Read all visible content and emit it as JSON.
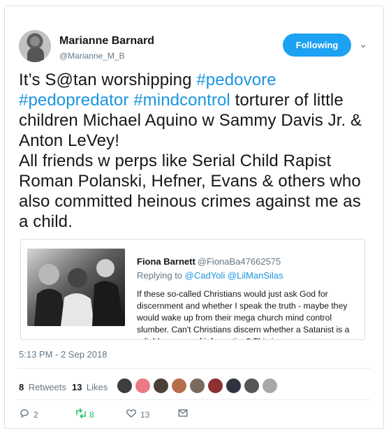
{
  "author": {
    "name": "Marianne Barnard",
    "handle": "@Marianne_M_B"
  },
  "follow_button_label": "Following",
  "tweet": {
    "text_parts": [
      "It’s S@tan worshipping ",
      "#pedovore",
      " ",
      "#pedopredator",
      " ",
      "#mindcontrol",
      " torturer of little children Michael Aquino w Sammy Davis Jr. & Anton LeVey!",
      "All friends w perps like Serial Child Rapist Roman Polanski, Hefner, Evans & others who also committed heinous crimes against me as a child."
    ]
  },
  "quoted_tweet": {
    "author_name": "Fiona Barnett",
    "author_handle": "@FionaBa47662575",
    "replying_to_label": "Replying to",
    "replying_to": [
      "@CadYoli",
      "@LilManSilas"
    ],
    "replying_to_separator": " ",
    "text": "If these so-called Christians would just ask God for discernment and whether I speak the truth - maybe they would wake up from their mega church mind control slumber. Can't Christians discern whether a Satanist is a reliable source of information? This is..."
  },
  "timestamp": "5:13 PM - 2 Sep 2018",
  "stats": {
    "retweets_count": "8",
    "retweets_label": "Retweets",
    "likes_count": "13",
    "likes_label": "Likes"
  },
  "actions": {
    "reply_count": "2",
    "retweet_count": "8",
    "like_count": "13"
  },
  "colors": {
    "accent": "#1da1f2",
    "link": "#1b95e0",
    "muted": "#657786",
    "retweet": "#17bf63"
  },
  "icons": [
    "profile-avatar",
    "chevron-down-icon",
    "reply-icon",
    "retweet-icon",
    "heart-icon",
    "message-icon"
  ]
}
